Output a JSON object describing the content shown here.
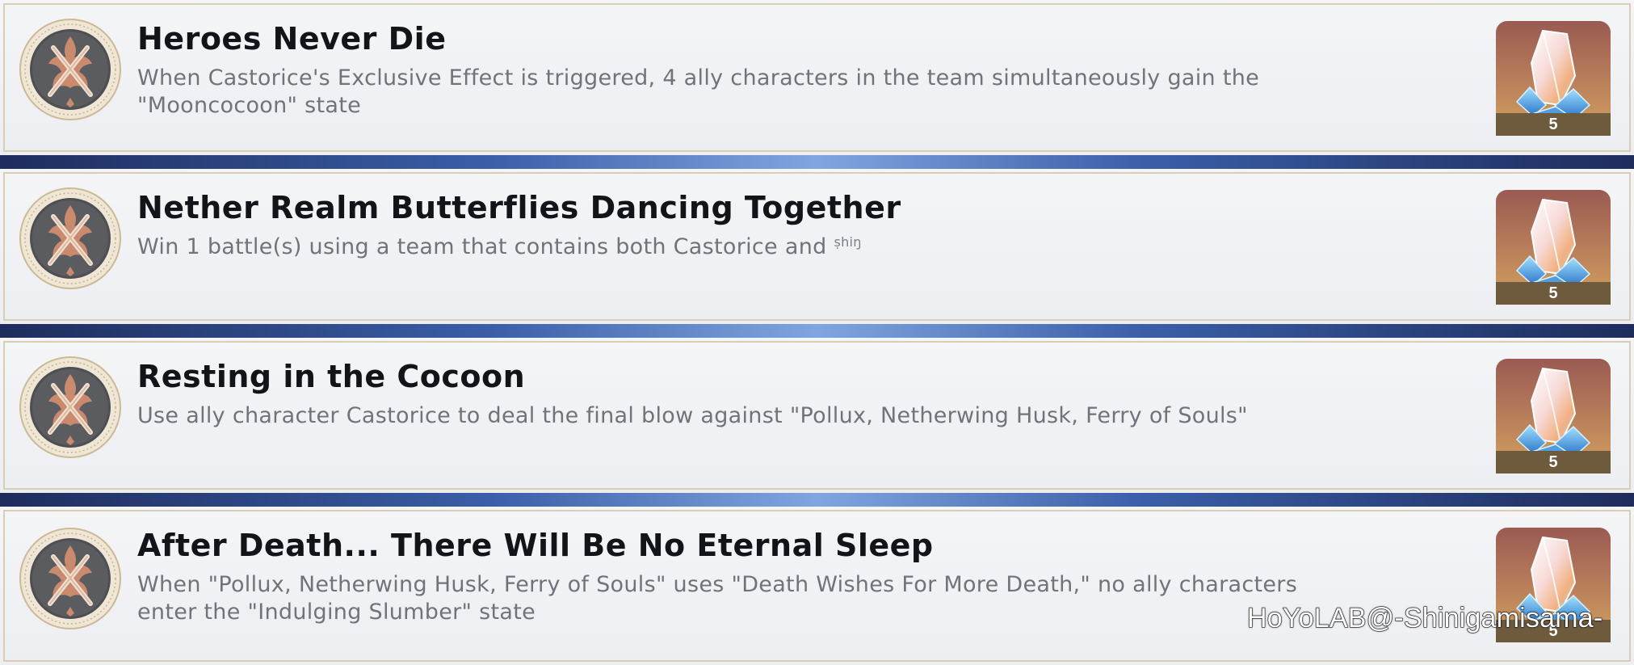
{
  "achievements": [
    {
      "title": "Heroes Never Die",
      "description": "When Castorice's Exclusive Effect is triggered, 4 ally characters in the team simultaneously gain the \"Mooncocoon\" state",
      "reward_count": "5",
      "medal_icon": "crossed-feathers-medal-icon",
      "reward_icon": "stellar-jade-icon"
    },
    {
      "title": "Nether Realm Butterflies Dancing Together",
      "description": "Win 1 battle(s) using a team that contains both Castorice and",
      "description_tag": "ṣhiŋ",
      "reward_count": "5",
      "medal_icon": "crossed-feathers-medal-icon",
      "reward_icon": "stellar-jade-icon"
    },
    {
      "title": "Resting in the Cocoon",
      "description": "Use ally character Castorice to deal the final blow against \"Pollux, Netherwing Husk, Ferry of Souls\"",
      "reward_count": "5",
      "medal_icon": "crossed-feathers-medal-icon",
      "reward_icon": "stellar-jade-icon"
    },
    {
      "title": "After Death... There Will Be No Eternal Sleep",
      "description": "When \"Pollux, Netherwing Husk, Ferry of Souls\" uses \"Death Wishes For More Death,\" no ally characters enter the \"Indulging Slumber\" state",
      "reward_count": "5",
      "medal_icon": "crossed-feathers-medal-icon",
      "reward_icon": "stellar-jade-icon"
    }
  ],
  "watermark": "HoYoLAB@-Shinigamisama-",
  "colors": {
    "card_bg": "#f1f2f5",
    "card_border": "#d9cdb8",
    "title": "#111419",
    "description": "#6f737b",
    "reward_top": "#9a5a52",
    "reward_bottom": "#d5a25f",
    "separator": "#3a5ea8"
  }
}
